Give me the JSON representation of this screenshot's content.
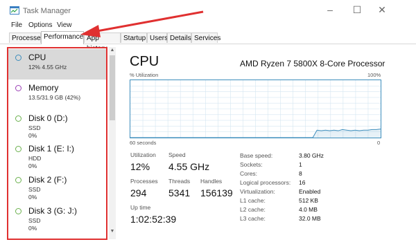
{
  "window": {
    "title": "Task Manager"
  },
  "menu": [
    "File",
    "Options",
    "View"
  ],
  "tabs": [
    "Processes",
    "Performance",
    "App history",
    "Startup",
    "Users",
    "Details",
    "Services"
  ],
  "active_tab": "Performance",
  "sidebar": {
    "items": [
      {
        "name": "CPU",
        "line1": "12% 4.55 GHz",
        "line2": "",
        "color": "#3c8dbc",
        "selected": true
      },
      {
        "name": "Memory",
        "line1": "13.5/31.9 GB (42%)",
        "line2": "",
        "color": "#9b3fb5",
        "selected": false
      },
      {
        "name": "Disk 0 (D:)",
        "line1": "SSD",
        "line2": "0%",
        "color": "#6ab04c",
        "selected": false
      },
      {
        "name": "Disk 1 (E: I:)",
        "line1": "HDD",
        "line2": "0%",
        "color": "#6ab04c",
        "selected": false
      },
      {
        "name": "Disk 2 (F:)",
        "line1": "SSD",
        "line2": "0%",
        "color": "#6ab04c",
        "selected": false
      },
      {
        "name": "Disk 3 (G: J:)",
        "line1": "SSD",
        "line2": "0%",
        "color": "#6ab04c",
        "selected": false
      }
    ]
  },
  "main": {
    "title": "CPU",
    "processor": "AMD Ryzen 7 5800X 8-Core Processor",
    "util_label": "% Utilization",
    "util_max": "100%",
    "seconds_label": "60 seconds",
    "graph_min": "0",
    "graph_color": "#3c8dbc",
    "util_history": [
      0,
      0,
      0,
      0,
      0,
      0,
      0,
      0,
      0,
      0,
      0,
      0,
      0,
      0,
      0,
      0,
      0,
      0,
      0,
      0,
      0,
      0,
      0,
      0,
      0,
      0,
      0,
      0,
      0,
      0,
      0,
      0,
      0,
      0,
      0,
      0,
      0,
      0,
      0,
      0,
      0,
      0,
      0,
      0,
      13,
      12,
      13,
      12,
      13,
      12,
      14,
      13,
      12,
      13,
      12,
      13,
      13,
      14,
      14,
      15
    ],
    "stats": {
      "utilization_label": "Utilization",
      "utilization": "12%",
      "speed_label": "Speed",
      "speed": "4.55 GHz",
      "processes_label": "Processes",
      "processes": "294",
      "threads_label": "Threads",
      "threads": "5341",
      "handles_label": "Handles",
      "handles": "156139",
      "uptime_label": "Up time",
      "uptime": "1:02:52:39"
    },
    "details": [
      {
        "key": "Base speed:",
        "value": "3.80 GHz"
      },
      {
        "key": "Sockets:",
        "value": "1"
      },
      {
        "key": "Cores:",
        "value": "8"
      },
      {
        "key": "Logical processors:",
        "value": "16"
      },
      {
        "key": "Virtualization:",
        "value": "Enabled"
      },
      {
        "key": "L1 cache:",
        "value": "512 KB"
      },
      {
        "key": "L2 cache:",
        "value": "4.0 MB"
      },
      {
        "key": "L3 cache:",
        "value": "32.0 MB"
      }
    ]
  },
  "annotation": {
    "color": "#e03030"
  }
}
